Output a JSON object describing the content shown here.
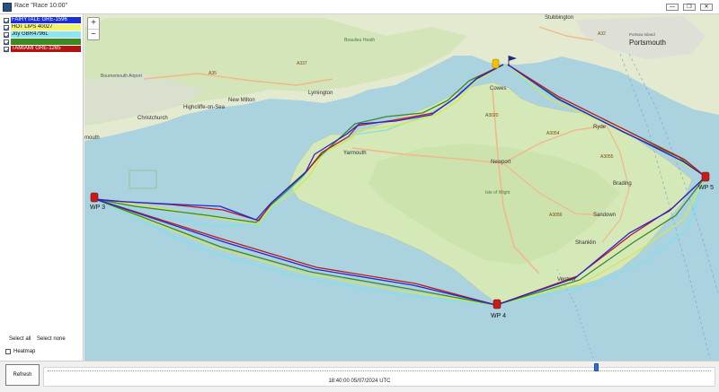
{
  "window": {
    "title": "Race \"Race 10:00\"",
    "btn_min": "—",
    "btn_max": "❐",
    "btn_close": "✕"
  },
  "boats": [
    {
      "label": "FAIRYTALE GRE-1596",
      "bg": "#1a2fd8",
      "fg": "#ffffff",
      "track": "#2a24d4"
    },
    {
      "label": "HOT LIPS 40027",
      "bg": "#f2f26e",
      "fg": "#111111",
      "track": "#d6e64e"
    },
    {
      "label": "Joy GBR4796L",
      "bg": "#8ee4f0",
      "fg": "#111111",
      "track": "#7fe0ee"
    },
    {
      "label": "",
      "bg": "#3c8a22",
      "fg": "#ffffff",
      "track": "#3c8a22"
    },
    {
      "label": "TAMIAMI GRE-1265",
      "bg": "#b11212",
      "fg": "#ffffff",
      "track": "#c01818"
    }
  ],
  "sidebar": {
    "select_all": "Select all",
    "select_none": "Select none",
    "heatmap": "Heatmap"
  },
  "map": {
    "zoom_in": "+",
    "zoom_out": "−",
    "places": {
      "stubbington": "Stubbington",
      "a32": "A32",
      "portsmouth": "Portsmouth",
      "portsea": "Portsea Island",
      "bournemouth": "Bournemouth Airport",
      "christchurch": "Christchurch",
      "highcliffe": "Highcliffe-on-Sea",
      "newmilton": "New Milton",
      "lymington": "Lymington",
      "a35": "A35",
      "a337": "A337",
      "beaulieu": "Beaulieu Heath",
      "cowes": "Cowes",
      "a3020": "A3020",
      "a3054": "A3054",
      "ryde": "Ryde",
      "a3055": "A3055",
      "yarmouth": "Yarmouth",
      "newport": "Newport",
      "isleofwight": "Isle of Wight",
      "brading": "Brading",
      "a3056": "A3056",
      "sandown": "Sandown",
      "shanklin": "Shanklin",
      "ventnor": "Ventnor",
      "mouth": "mouth"
    },
    "waypoints": {
      "wp3": "WP 3",
      "wp4": "WP 4",
      "wp5": "WP 5"
    }
  },
  "bottom": {
    "refresh": "Refresh",
    "timestamp": "18:40:00 05/07/2024 UTC",
    "playhead": 0.823
  }
}
